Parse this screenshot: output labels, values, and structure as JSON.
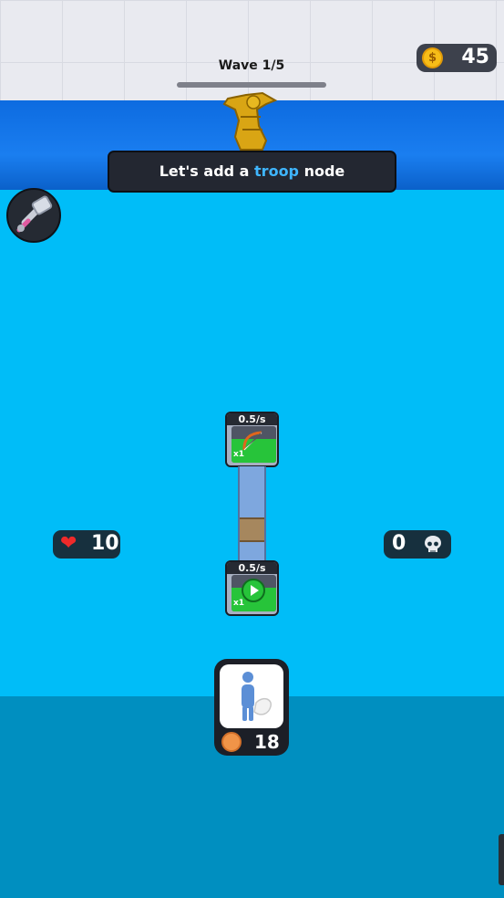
{
  "hud": {
    "wave_label": "Wave 1/5",
    "wave_progress": 0.0,
    "coins": "45",
    "health": "10",
    "kills": "0"
  },
  "hint": {
    "prefix": "Let's add a ",
    "highlight": "troop",
    "suffix": " node"
  },
  "nodes": [
    {
      "rate": "0.5/s",
      "multiplier": "x1",
      "icon": "bow-icon"
    },
    {
      "rate": "0.5/s",
      "multiplier": "x1",
      "icon": "play-icon"
    }
  ],
  "troop_card": {
    "cost": "18",
    "icon": "troop-figure-icon"
  },
  "colors": {
    "field": "#00bdf8",
    "wall": "#1a7ef0",
    "bottom": "#008fc0",
    "hint_highlight": "#3fb6ff",
    "coin": "#f7bd18",
    "heart": "#ee2a2a",
    "node_green": "#27c43a"
  }
}
